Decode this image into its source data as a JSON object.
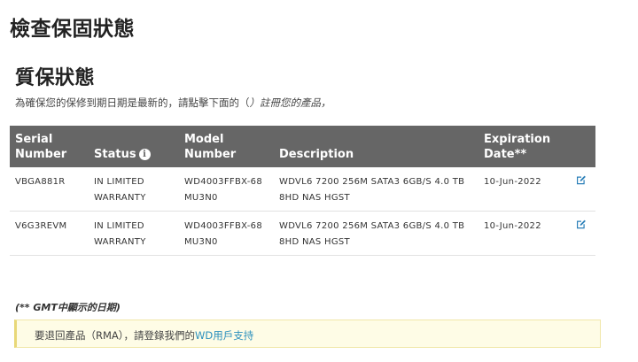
{
  "page": {
    "title": "檢查保固狀態"
  },
  "warranty": {
    "heading": "質保狀態",
    "instruction_prefix": "為確保您的保修到期日期是最新的，請點擊下面的（",
    "instruction_link": "）註冊您的產品，",
    "table": {
      "headers": {
        "serial": "Serial Number",
        "status": "Status",
        "status_info_icon": "i",
        "model": "Model Number",
        "description": "Description",
        "expiration": "Expiration Date**"
      },
      "rows": [
        {
          "serial": "VBGA881R",
          "status": "IN LIMITED WARRANTY",
          "model": "WD4003FFBX-68MU3N0",
          "description": "WDVL6 7200 256M SATA3 6GB/S 4.0 TB 8HD NAS HGST",
          "expiration": "10-Jun-2022",
          "action_icon": "edit-icon"
        },
        {
          "serial": "V6G3REVM",
          "status": "IN LIMITED WARRANTY",
          "model": "WD4003FFBX-68MU3N0",
          "description": "WDVL6 7200 256M SATA3 6GB/S 4.0 TB 8HD NAS HGST",
          "expiration": "10-Jun-2022",
          "action_icon": "edit-icon"
        }
      ]
    },
    "footnote": "(** GMT中顯示的日期)"
  },
  "rma": {
    "text": "要退回產品（RMA），請登錄我們的",
    "link": "WD用戶支持"
  },
  "colors": {
    "header_bg": "#666666",
    "link": "#2a8fbd",
    "notice_bg": "#fefce6",
    "notice_border": "#e8d878"
  }
}
